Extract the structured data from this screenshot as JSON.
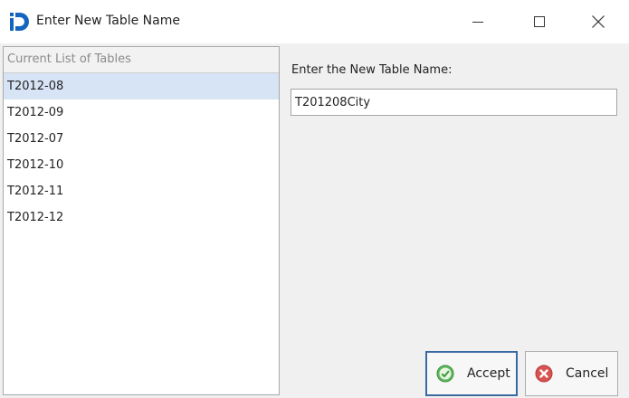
{
  "window": {
    "title": "Enter New Table Name",
    "controls": {
      "minimize": "minimize-icon",
      "maximize": "maximize-icon",
      "close": "close-icon"
    }
  },
  "tables_list": {
    "header": "Current List of Tables",
    "items": [
      "T2012-08",
      "T2012-09",
      "T2012-07",
      "T2012-10",
      "T2012-11",
      "T2012-12"
    ],
    "selected_index": 0
  },
  "form": {
    "label": "Enter the New Table Name:",
    "value": "T201208City"
  },
  "buttons": {
    "accept": {
      "label": "Accept",
      "icon": "check-circle-icon",
      "color": "#5cb85c"
    },
    "cancel": {
      "label": "Cancel",
      "icon": "x-circle-icon",
      "color": "#d9534f"
    }
  },
  "colors": {
    "selection": "#d7e4f5",
    "app_icon": "#1565c0",
    "default_button_border": "#3b6aa0"
  }
}
